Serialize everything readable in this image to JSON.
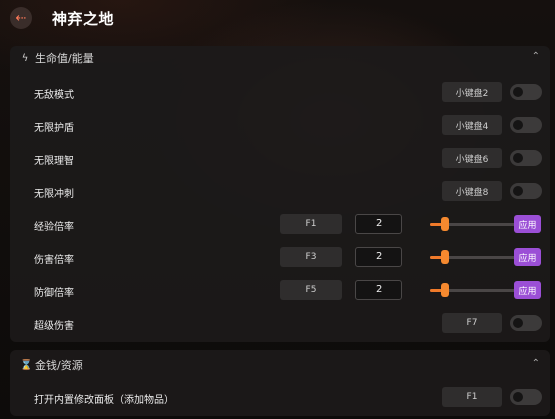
{
  "header": {
    "back_icon": "arrow-left-icon",
    "title": "神弃之地"
  },
  "sections": [
    {
      "icon": "lightning-icon",
      "title": "生命值/能量",
      "expanded": true,
      "rows": [
        {
          "label": "无敌模式",
          "hotkey": "小键盘2",
          "enabled": false
        },
        {
          "label": "无限护盾",
          "hotkey": "小键盘4",
          "enabled": false
        },
        {
          "label": "无限理智",
          "hotkey": "小键盘6",
          "enabled": false
        },
        {
          "label": "无限冲刺",
          "hotkey": "小键盘8",
          "enabled": false
        },
        {
          "label": "经验倍率",
          "hotkey": "F1",
          "value": "2",
          "slider_fraction": 0.18,
          "apply_label": "应用"
        },
        {
          "label": "伤害倍率",
          "hotkey": "F3",
          "value": "2",
          "slider_fraction": 0.18,
          "apply_label": "应用"
        },
        {
          "label": "防御倍率",
          "hotkey": "F5",
          "value": "2",
          "slider_fraction": 0.18,
          "apply_label": "应用"
        },
        {
          "label": "超级伤害",
          "hotkey": "F7",
          "enabled": false
        }
      ]
    },
    {
      "icon": "money-bag-icon",
      "title": "金钱/资源",
      "expanded": true,
      "rows": [
        {
          "label": "打开内置修改面板（添加物品）",
          "hotkey": "F1",
          "enabled": false
        }
      ]
    }
  ],
  "colors": {
    "accent_orange": "#f07a2a",
    "apply_purple": "#9b4fd6",
    "back_arrow": "#ff7a5a"
  }
}
